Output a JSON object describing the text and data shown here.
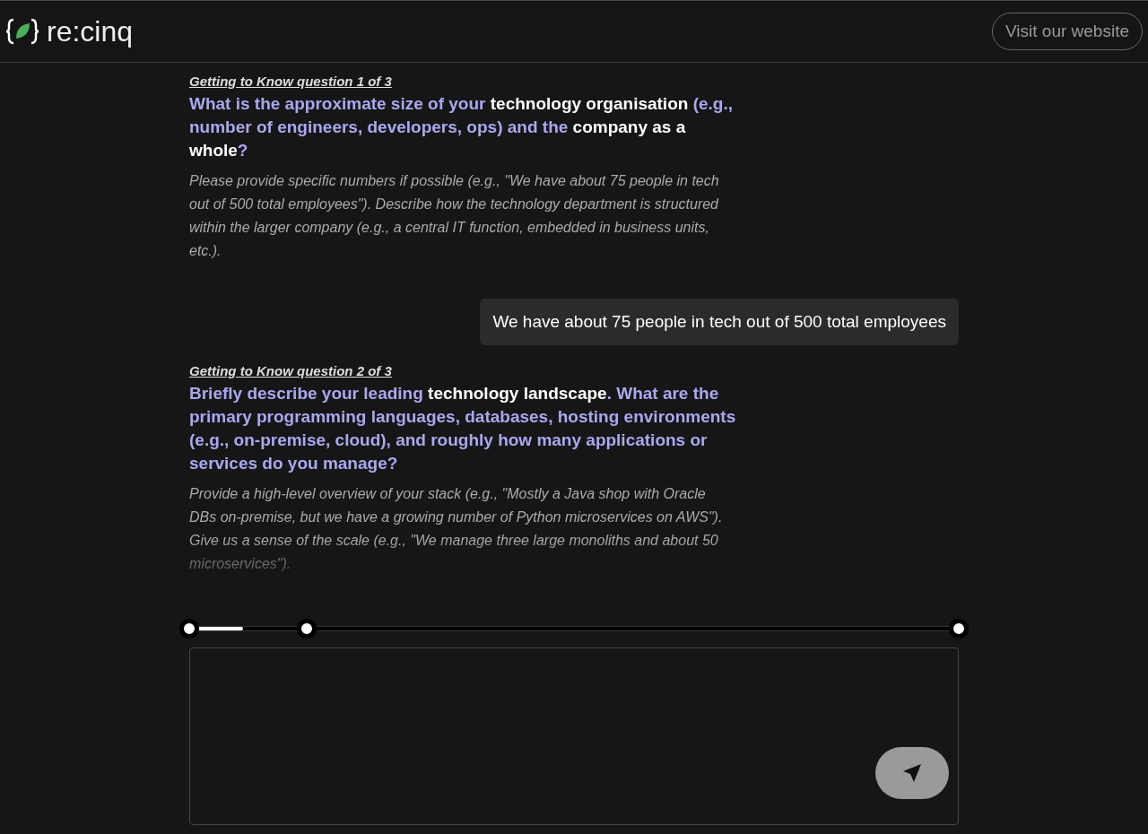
{
  "header": {
    "logo_text": "re:cinq",
    "website_button": "Visit our website"
  },
  "messages": [
    {
      "kind": "question",
      "label": "Getting to Know question 1 of 3",
      "question": "What is the approximate size of your **technology organisation** (e.g., number of engineers, developers, ops) and the **company as a whole**?",
      "hint": "Please provide specific numbers if possible (e.g., \"We have about 75 people in tech out of 500 total employees\"). Describe how the technology department is structured within the larger company (e.g., a central IT function, embedded in business units, etc.)."
    },
    {
      "kind": "answer",
      "text": "We have about 75 people in tech out of 500 total employees"
    },
    {
      "kind": "question",
      "label": "Getting to Know question 2 of 3",
      "question": "Briefly describe your leading **technology landscape**. What are the primary programming languages, databases, hosting environments (e.g., on-premise, cloud), and roughly how many applications or services do you manage?",
      "hint": "Provide a high-level overview of your stack (e.g., \"Mostly a Java shop with Oracle DBs on-premise, but we have a growing number of Python microservices on AWS\"). Give us a sense of the scale (e.g., \"We manage three large monoliths and about 50 microservices\")."
    }
  ],
  "progress": {
    "level": 0.07
  },
  "composer": {
    "send_disabled": true
  }
}
